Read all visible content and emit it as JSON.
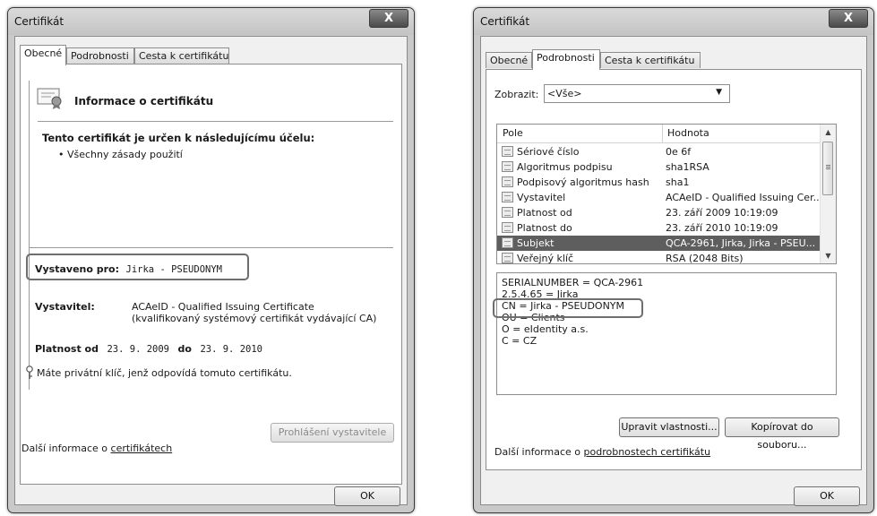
{
  "window1": {
    "title": "Certifikát",
    "close_label": "X",
    "tabs": [
      "Obecné",
      "Podrobnosti",
      "Cesta k certifikátu"
    ],
    "header_title": "Informace o certifikátu",
    "purpose_heading": "Tento certifikát je určen k následujícímu účelu:",
    "purpose_item": "• Všechny zásady použití",
    "issued_to_label": "Vystaveno pro:",
    "issued_to_value": "Jirka - PSEUDONYM",
    "issuer_label": "Vystavitel:",
    "issuer_line1": "ACAeID - Qualified Issuing Certificate",
    "issuer_line2": "(kvalifikovaný systémový certifikát vydávající CA)",
    "valid_from_label": "Platnost od",
    "valid_from_value": "23. 9. 2009",
    "valid_to_label": "do",
    "valid_to_value": "23. 9. 2010",
    "private_key_note": "Máte privátní klíč, jenž odpovídá tomuto certifikátu.",
    "issuer_statement_button": "Prohlášení vystavitele",
    "more_info_prefix": "Další informace o",
    "more_info_link": "certifikátech",
    "ok_button": "OK"
  },
  "window2": {
    "title": "Certifikát",
    "close_label": "X",
    "tabs": [
      "Obecné",
      "Podrobnosti",
      "Cesta k certifikátu"
    ],
    "show_label": "Zobrazit:",
    "show_value": "<Vše>",
    "columns": [
      "Pole",
      "Hodnota"
    ],
    "rows": [
      {
        "field": "Sériové číslo",
        "value": "0e 6f"
      },
      {
        "field": "Algoritmus podpisu",
        "value": "sha1RSA"
      },
      {
        "field": "Podpisový algoritmus hash",
        "value": "sha1"
      },
      {
        "field": "Vystavitel",
        "value": "ACAeID - Qualified Issuing Cer..."
      },
      {
        "field": "Platnost od",
        "value": "23. září 2009 10:19:09"
      },
      {
        "field": "Platnost do",
        "value": "23. září 2010 10:19:09"
      },
      {
        "field": "Subjekt",
        "value": "QCA-2961, Jirka, Jirka - PSEU..."
      },
      {
        "field": "Veřejný klíč",
        "value": "RSA (2048 Bits)"
      }
    ],
    "selected_row": 6,
    "detail_lines": [
      "SERIALNUMBER = QCA-2961",
      "2.5.4.65 = Jirka",
      "CN = Jirka - PSEUDONYM",
      "OU = Clients",
      "O = eIdentity a.s.",
      "C = CZ"
    ],
    "edit_properties_button": "Upravit vlastnosti...",
    "copy_to_file_button": "Kopírovat do souboru...",
    "more_info_prefix": "Další informace o",
    "more_info_link": "podrobnostech certifikátu",
    "ok_button": "OK"
  }
}
